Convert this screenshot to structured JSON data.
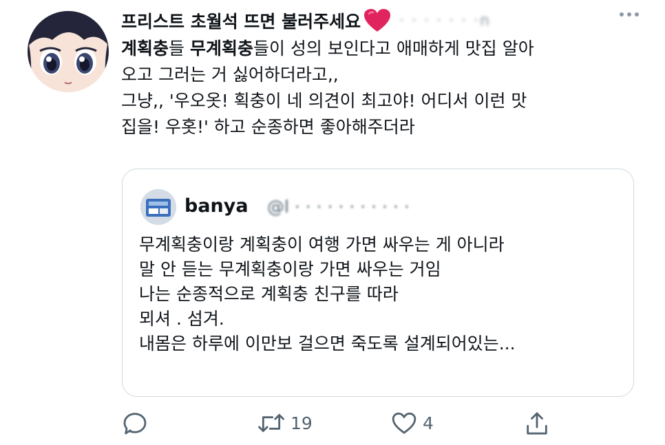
{
  "tweet": {
    "display_name": "프리스트 초월석 뜨면 불러주세요",
    "handle": "· · · · ·  · ·n",
    "text_lines": [
      [
        {
          "t": "계획충",
          "b": true
        },
        {
          "t": "들 "
        },
        {
          "t": "무계획충",
          "b": true
        },
        {
          "t": "들이 성의 보인다고 애매하게 맛집 알아"
        }
      ],
      [
        {
          "t": "오고 그러는 거 싫어하더라고,,"
        }
      ],
      [
        {
          "t": "그냥,, '우오옷! 획충이 네 의견이 최고야! 어디서 이런 맛"
        }
      ],
      [
        {
          "t": "집을! 우홋!' 하고 순종하면 좋아해주더라"
        }
      ]
    ]
  },
  "quote": {
    "name": "banya",
    "handle": "@l  ·  ·   ·   ·  ·  ·  ·  ·  ·  ·  ·",
    "lines": [
      "무계획충이랑 계획충이 여행 가면 싸우는 게 아니라",
      "말 안 듣는 무계획충이랑 가면 싸우는 거임",
      "나는 순종적으로 계획충 친구를 따라",
      "뫼셔 . 섬겨.",
      "내몸은 하루에 이만보 걸으면 죽도록 설계되어있는..."
    ]
  },
  "actions": {
    "reply_icon": "reply-icon",
    "retweet_icon": "retweet-icon",
    "retweet_count": "19",
    "like_icon": "heart-outline-icon",
    "like_count": "4",
    "share_icon": "share-icon"
  },
  "colors": {
    "text": "#0f1419",
    "muted": "#536471",
    "border": "#cfd9de",
    "heart": "#e0245e"
  }
}
